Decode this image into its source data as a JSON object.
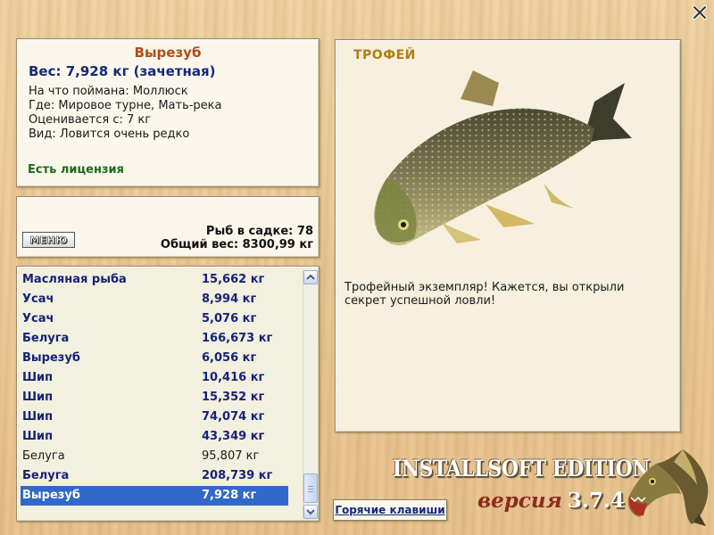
{
  "window": {
    "close_symbol": "X"
  },
  "info": {
    "name": "Вырезуб",
    "weight": "Вес: 7,928 кг (зачетная)",
    "caught_on": "На что поймана: Моллюск",
    "where": "Где: Мировое турне, Мать-река",
    "rated_from": "Оценивается с: 7 кг",
    "kind": "Вид: Ловится очень редко",
    "license": "Есть лицензия"
  },
  "keepnet": {
    "menu_label": "МЕНЮ",
    "fish_count": "Рыб в садке: 78",
    "total_weight": "Общий вес: 8300,99 кг"
  },
  "catch_list": [
    {
      "name": "Масляная рыба",
      "weight": "15,662 кг",
      "style": "trophy"
    },
    {
      "name": "Усач",
      "weight": "8,994 кг",
      "style": "trophy"
    },
    {
      "name": "Усач",
      "weight": "5,076 кг",
      "style": "trophy"
    },
    {
      "name": "Белуга",
      "weight": "166,673 кг",
      "style": "trophy"
    },
    {
      "name": "Вырезуб",
      "weight": "6,056 кг",
      "style": "trophy"
    },
    {
      "name": "Шип",
      "weight": "10,416 кг",
      "style": "trophy"
    },
    {
      "name": "Шип",
      "weight": "15,352 кг",
      "style": "trophy"
    },
    {
      "name": "Шип",
      "weight": "74,074 кг",
      "style": "trophy"
    },
    {
      "name": "Шип",
      "weight": "43,349 кг",
      "style": "trophy"
    },
    {
      "name": "Белуга",
      "weight": "95,807 кг",
      "style": "normal"
    },
    {
      "name": "Белуга",
      "weight": "208,739 кг",
      "style": "trophy"
    },
    {
      "name": "Вырезуб",
      "weight": "7,928 кг",
      "style": "selected"
    }
  ],
  "trophy": {
    "title": "ТРОФЕЙ",
    "image_icon": "fish-image",
    "message": "Трофейный экземпляр! Кажется, вы открыли секрет успешной ловли!"
  },
  "hotkeys": {
    "label": "Горячие клавиши"
  },
  "branding": {
    "edition": "INSTALLSOFT EDITION",
    "version_word": "версия",
    "version_number": "3.7.4",
    "logo_icon": "pike-icon"
  },
  "colors": {
    "accent_name": "#b24a14",
    "trophy_text": "#16227a",
    "license_green": "#1d6a1d",
    "selection": "#3168c9",
    "trophy_title": "#b27d12"
  }
}
